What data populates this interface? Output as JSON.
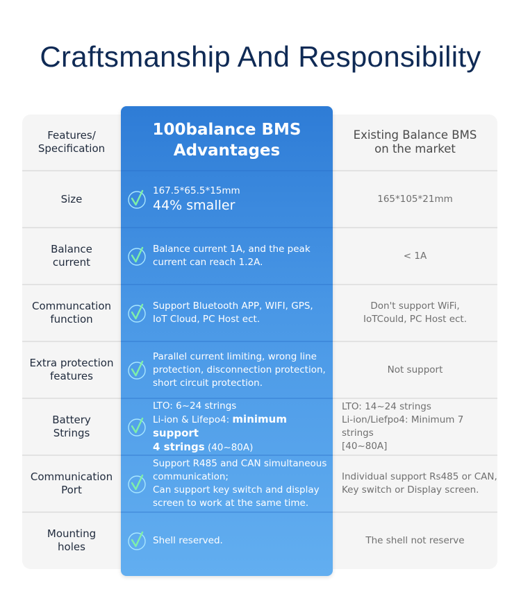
{
  "title": "Craftsmanship And Responsibility",
  "colors": {
    "title": "#0f2a55",
    "accent_blue": "#2e7cd6",
    "check_green": "#7ff0a8",
    "card_bg": "#f5f5f5"
  },
  "table": {
    "headers": {
      "features": "Features/\nSpecification",
      "advantages_line1": "100balance BMS",
      "advantages_line2": "Advantages",
      "market": "Existing Balance BMS\non the market"
    },
    "rows": [
      {
        "feature": "Size",
        "advantage": {
          "line1": "167.5*65.5*15mm",
          "line2": "44% smaller"
        },
        "market": "165*105*21mm"
      },
      {
        "feature": "Balance\ncurrent",
        "advantage": {
          "text": "Balance current 1A, and the peak\n current can reach 1.2A."
        },
        "market": "< 1A"
      },
      {
        "feature": "Communcation\nfunction",
        "advantage": {
          "text": "Support Bluetooth APP, WIFI, GPS,\nIoT Cloud, PC Host ect."
        },
        "market": "Don't support WiFi,\nIoTCould, PC Host ect."
      },
      {
        "feature": "Extra protection\nfeatures",
        "advantage": {
          "text": "Parallel current limiting, wrong line\nprotection, disconnection protection,\nshort circuit protection."
        },
        "market": "Not support"
      },
      {
        "feature": "Battery\nStrings",
        "advantage": {
          "line1": "LTO: 6~24 strings",
          "line2_prefix": "Li-ion & Lifepo4: ",
          "line2_bold": "minimum support",
          "line3_bold": "4 strings",
          "line3_suffix": " (40~80A)"
        },
        "market": "LTO: 14~24 strings\nLi-ion/Liefpo4: Minimum 7 strings\n[40~80A]"
      },
      {
        "feature": "Communication\nPort",
        "advantage": {
          "text": "Support R485 and CAN simultaneous\n communication;\nCan support key switch and display\nscreen to work at the same time."
        },
        "market": "Individual support Rs485 or CAN,\nKey switch or Display screen."
      },
      {
        "feature": "Mounting\nholes",
        "advantage": {
          "text": "Shell reserved."
        },
        "market": "The shell not reserve"
      }
    ]
  },
  "icons": {
    "check": "check-circle-icon"
  }
}
